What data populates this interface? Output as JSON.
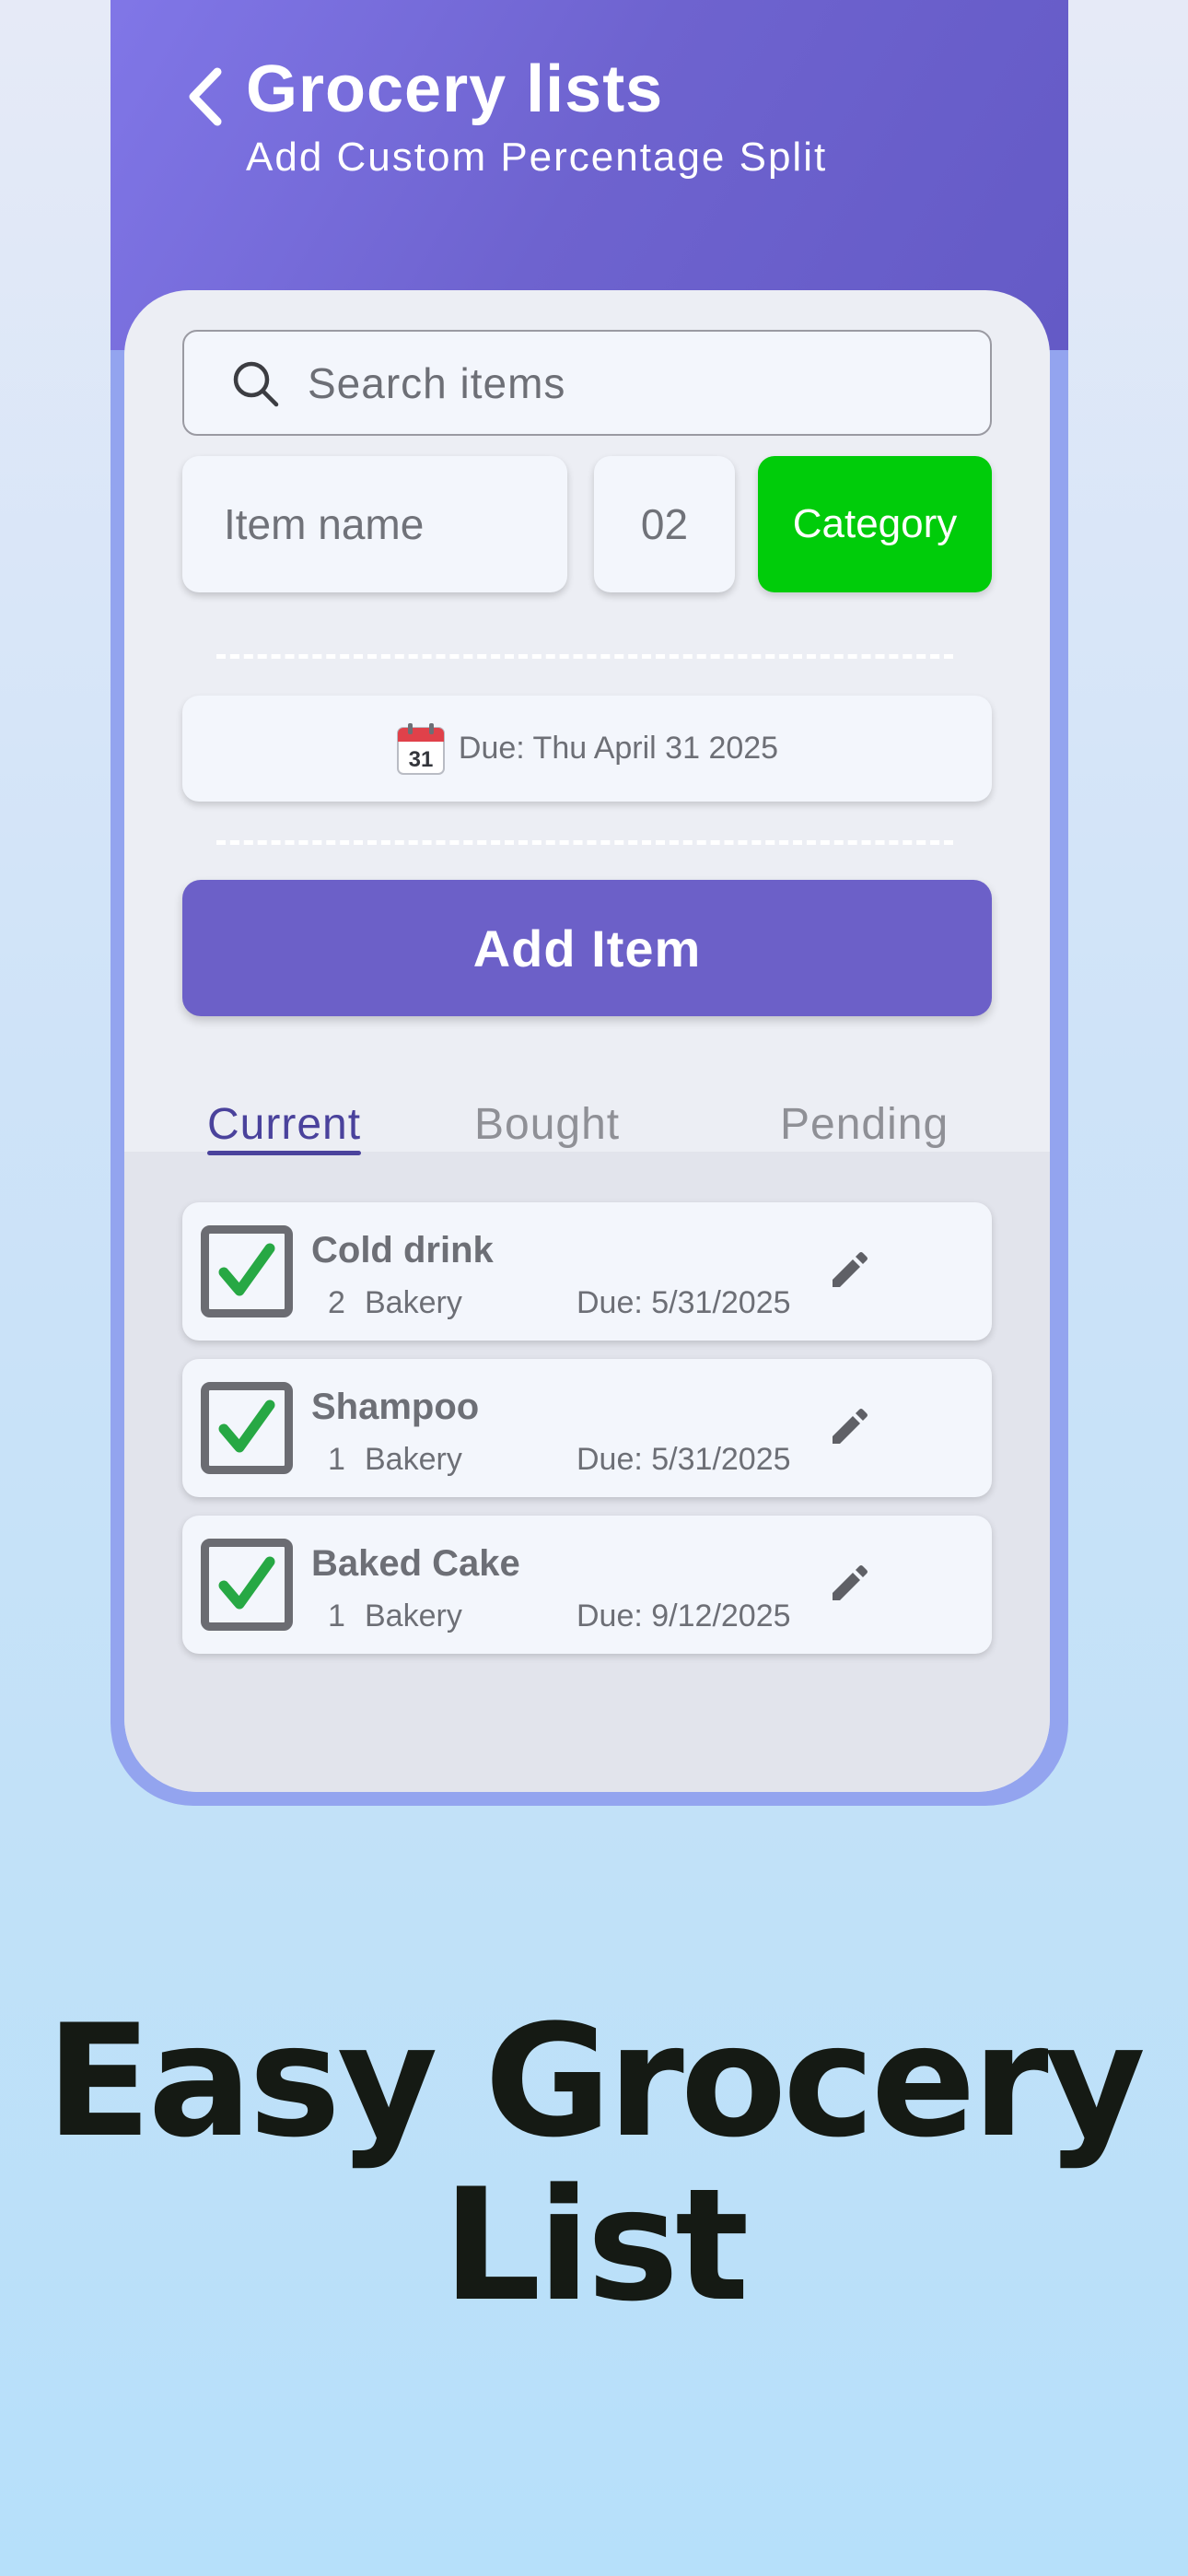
{
  "header": {
    "title": "Grocery lists",
    "subtitle": "Add Custom Percentage Split"
  },
  "search": {
    "placeholder": "Search items"
  },
  "form": {
    "item_name_placeholder": "Item name",
    "quantity": "02",
    "category_label": "Category",
    "due_label": "Due: Thu April 31 2025",
    "calendar_day": "31",
    "add_button_label": "Add Item"
  },
  "tabs": [
    {
      "label": "Current",
      "active": true
    },
    {
      "label": "Bought",
      "active": false
    },
    {
      "label": "Pending",
      "active": false
    }
  ],
  "items": [
    {
      "name": "Cold drink",
      "qty": "2",
      "category": "Bakery",
      "due": "Due: 5/31/2025",
      "checked": true
    },
    {
      "name": "Shampoo",
      "qty": "1",
      "category": "Bakery",
      "due": "Due: 5/31/2025",
      "checked": true
    },
    {
      "name": "Baked Cake",
      "qty": "1",
      "category": "Bakery",
      "due": "Due: 9/12/2025",
      "checked": true
    }
  ],
  "headline": {
    "line1": "Easy Grocery",
    "line2": "List"
  },
  "colors": {
    "header_accent": "#6e63cf",
    "category_button": "#00cc0a",
    "add_button": "#6c60c8",
    "check_green": "#27a844",
    "active_tab": "#4a429c"
  },
  "icons": [
    "back-icon",
    "search-icon",
    "calendar-icon",
    "check-icon",
    "edit-icon"
  ]
}
